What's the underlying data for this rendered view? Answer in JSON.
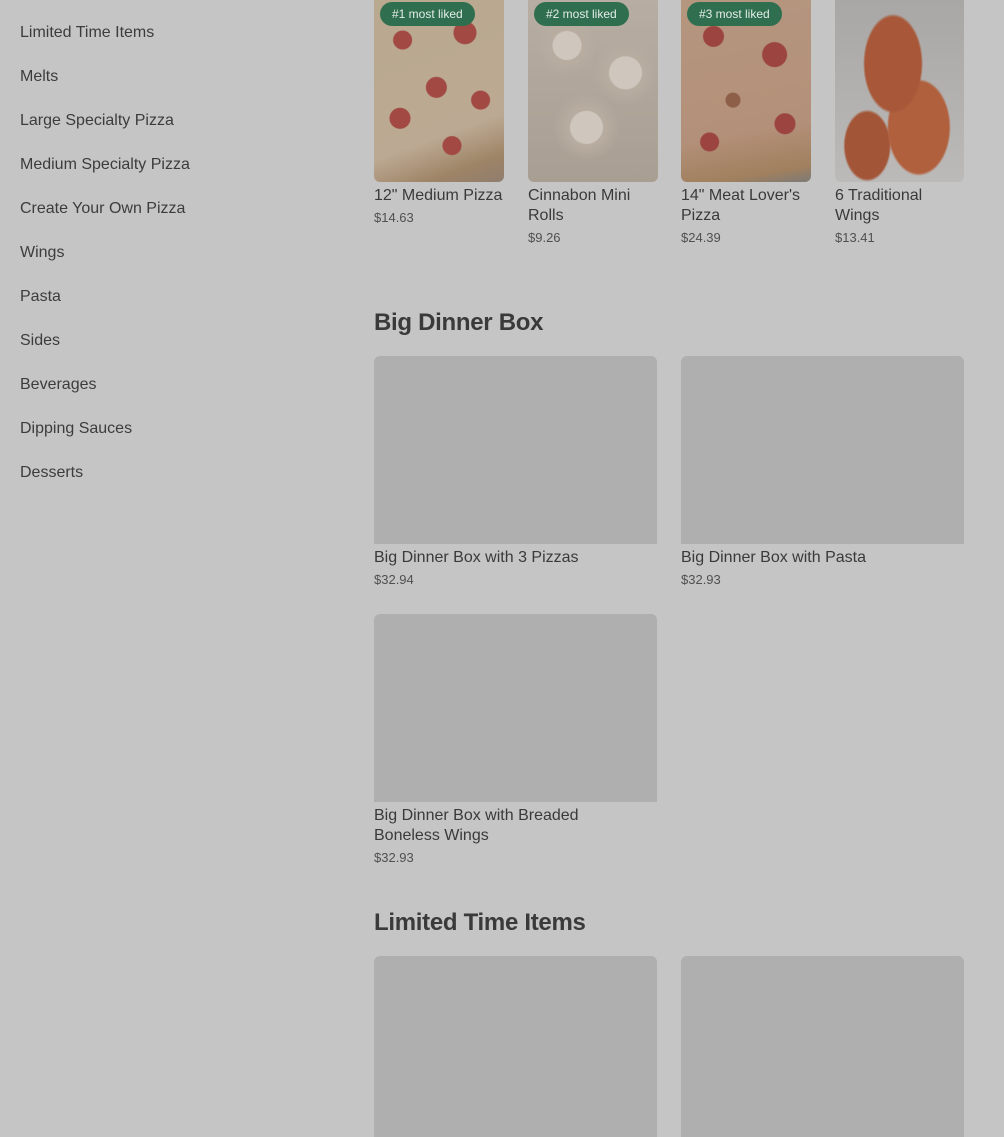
{
  "sidebar": {
    "items": [
      {
        "label": "Limited Time Items"
      },
      {
        "label": "Melts"
      },
      {
        "label": "Large Specialty Pizza"
      },
      {
        "label": "Medium Specialty Pizza"
      },
      {
        "label": "Create Your Own Pizza"
      },
      {
        "label": "Wings"
      },
      {
        "label": "Pasta"
      },
      {
        "label": "Sides"
      },
      {
        "label": "Beverages"
      },
      {
        "label": "Dipping Sauces"
      },
      {
        "label": "Desserts"
      }
    ]
  },
  "most_liked": [
    {
      "badge": "#1 most liked",
      "name": "12\" Medium Pizza",
      "price": "$14.63",
      "image": "pepperoni-pizza"
    },
    {
      "badge": "#2 most liked",
      "name": "Cinnabon Mini Rolls",
      "price": "$9.26",
      "image": "cinnamon-rolls"
    },
    {
      "badge": "#3 most liked",
      "name": "14\" Meat Lover's Pizza",
      "price": "$24.39",
      "image": "meat-pizza"
    },
    {
      "badge": "",
      "name": "6 Traditional Wings",
      "price": "$13.41",
      "image": "wings"
    }
  ],
  "sections": [
    {
      "title": "Big Dinner Box",
      "items": [
        {
          "name": "Big Dinner Box with 3 Pizzas",
          "price": "$32.94"
        },
        {
          "name": "Big Dinner Box with Pasta",
          "price": "$32.93"
        },
        {
          "name": "Big Dinner Box with Breaded Boneless Wings",
          "price": "$32.93"
        }
      ]
    },
    {
      "title": "Limited Time Items",
      "items": [
        {
          "name": "",
          "price": ""
        },
        {
          "name": "",
          "price": ""
        }
      ]
    }
  ],
  "colors": {
    "overlay_bg": "#c5c5c5",
    "badge_bg": "#2f6f4f",
    "placeholder": "#afafaf"
  }
}
